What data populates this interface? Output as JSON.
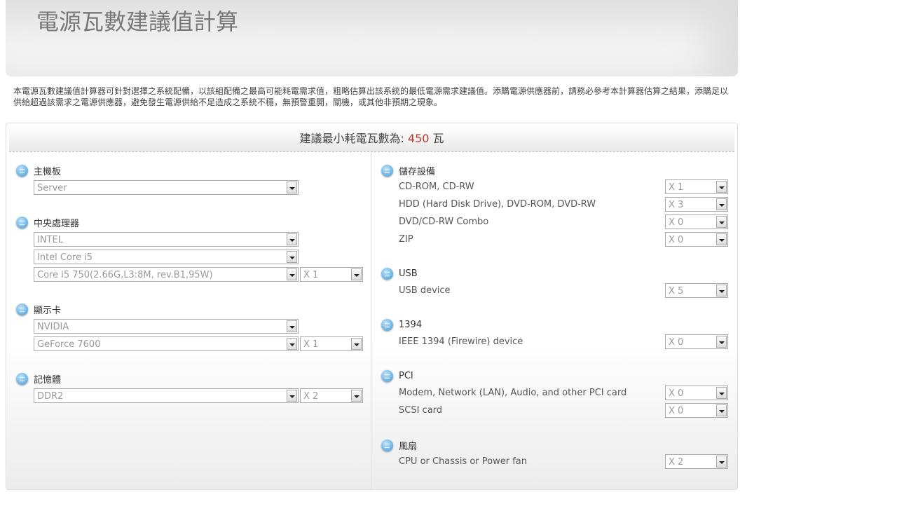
{
  "title": "電源瓦數建議值計算",
  "description": "本電源瓦數建議值計算器可針對選擇之系統配備，以該組配備之最高可能耗電需求值，粗略估算出該系統的最低電源需求建議值。添購電源供應器前，請務必參考本計算器估算之結果，添購足以供給超過該需求之電源供應器，避免發生電源供給不足造成之系統不穩，無預警重開，關機，或其他非預期之現象。",
  "result": {
    "label": "建議最小耗電瓦數為: ",
    "value": "450",
    "unit": " 瓦"
  },
  "left": {
    "motherboard": {
      "title": "主機板",
      "value": "Server"
    },
    "cpu": {
      "title": "中央處理器",
      "brand": "INTEL",
      "series": "Intel Core i5",
      "model": "Core i5 750(2.66G,L3:8M, rev.B1,95W)",
      "qty": "X 1"
    },
    "gpu": {
      "title": "顯示卡",
      "brand": "NVIDIA",
      "model": "GeForce 7600",
      "qty": "X 1"
    },
    "memory": {
      "title": "記憶體",
      "type": "DDR2",
      "qty": "X 2"
    }
  },
  "right": {
    "storage": {
      "title": "儲存設備",
      "items": [
        {
          "label": "CD-ROM, CD-RW",
          "qty": "X 1"
        },
        {
          "label": "HDD (Hard Disk Drive), DVD-ROM, DVD-RW",
          "qty": "X 3"
        },
        {
          "label": "DVD/CD-RW Combo",
          "qty": "X 0"
        },
        {
          "label": "ZIP",
          "qty": "X 0"
        }
      ]
    },
    "usb": {
      "title": "USB",
      "items": [
        {
          "label": "USB device",
          "qty": "X 5"
        }
      ]
    },
    "ieee": {
      "title": "1394",
      "items": [
        {
          "label": "IEEE 1394 (Firewire) device",
          "qty": "X 0"
        }
      ]
    },
    "pci": {
      "title": "PCI",
      "items": [
        {
          "label": "Modem, Network (LAN), Audio, and other PCI card",
          "qty": "X 0"
        },
        {
          "label": "SCSI card",
          "qty": "X 0"
        }
      ]
    },
    "fan": {
      "title": "風扇",
      "items": [
        {
          "label": "CPU or Chassis or Power fan",
          "qty": "X 2"
        }
      ]
    }
  }
}
